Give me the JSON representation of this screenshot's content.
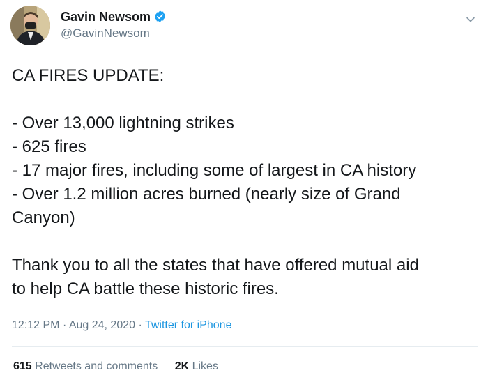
{
  "author": {
    "name": "Gavin Newsom",
    "handle": "@GavinNewsom",
    "verified": true
  },
  "tweet": {
    "lines": [
      "CA FIRES UPDATE:",
      "",
      "- Over 13,000 lightning strikes",
      "- 625 fires",
      "- 17 major fires, including some of largest in CA history",
      "- Over 1.2 million acres burned (nearly size of Grand",
      "Canyon)",
      "",
      "Thank you to all the states that have offered mutual aid",
      "to help CA battle these historic fires."
    ]
  },
  "meta": {
    "time": "12:12 PM",
    "separator1": "·",
    "date": "Aug 24, 2020",
    "separator2": "·",
    "source": "Twitter for iPhone"
  },
  "stats": {
    "retweets_count": "615",
    "retweets_label": "Retweets and comments",
    "likes_count": "2K",
    "likes_label": "Likes"
  },
  "icons": {
    "verified": "verified-badge-icon",
    "menu": "chevron-down-icon"
  },
  "colors": {
    "text": "#14171a",
    "secondary": "#657786",
    "link": "#1b95e0",
    "verified": "#1da1f2",
    "divider": "#e6ecf0"
  }
}
